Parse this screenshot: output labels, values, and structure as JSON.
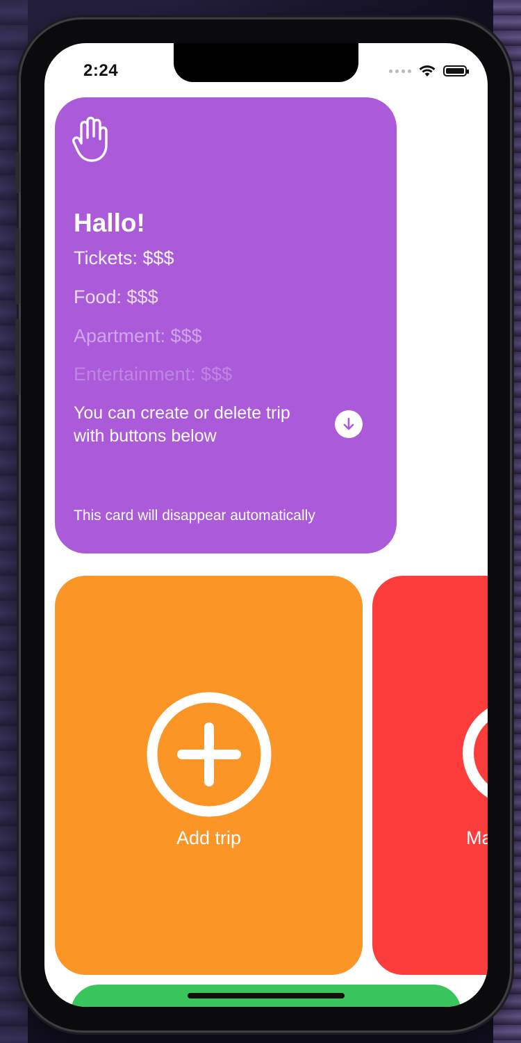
{
  "status_bar": {
    "time": "2:24",
    "icons": [
      "cellular-icon",
      "wifi-icon",
      "battery-icon"
    ]
  },
  "welcome_card": {
    "icon": "hand-raised-icon",
    "title": "Hallo!",
    "cost_lines": [
      "Tickets: $$$",
      "Food: $$$",
      "Apartment: $$$",
      "Entertainment: $$$"
    ],
    "hint": "You can create or delete trip with buttons below",
    "hint_icon": "arrow-down-circle-icon",
    "footnote": "This card will disappear automatically",
    "color": "#AB5BDA"
  },
  "add_trip_card": {
    "icon": "plus-circle-icon",
    "label": "Add trip",
    "color": "#FB9526"
  },
  "manage_card": {
    "icon": "circle-icon",
    "label_visible": "Ma",
    "color": "#FD3D3B"
  },
  "bottom_card": {
    "color": "#3AC55C"
  }
}
